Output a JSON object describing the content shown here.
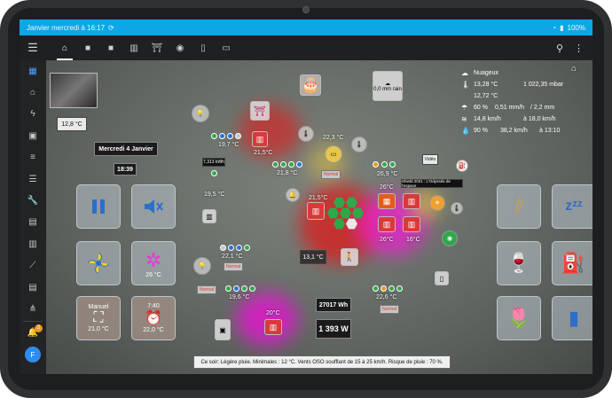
{
  "status_bar": {
    "time_text": "Janvier mercredi à 16:17",
    "battery": "100%"
  },
  "toolbar": {
    "tabs": [
      "home",
      "square-1",
      "square-2",
      "radiator",
      "gate",
      "eye",
      "phone",
      "tv"
    ],
    "search_icon": "search-icon",
    "more_icon": "more-vertical-icon"
  },
  "sidebar": {
    "items": [
      "dashboard",
      "home",
      "energy",
      "screen",
      "list",
      "list-alt",
      "wrench",
      "chart-bar",
      "server",
      "chart-line",
      "document",
      "network"
    ],
    "notification_count": "2",
    "user_initial": "F"
  },
  "camera": {
    "label": "camera-feed"
  },
  "temps": {
    "indoor_main": "12,8 °C",
    "date": "Mercredi 4 Janvier",
    "time": "18:39",
    "t1": "19,7 °C",
    "t2": "21,5°C",
    "t3": "21,8 °C",
    "t4": "22,3 °C",
    "t5": "26,9 °C",
    "t6": "19,5 °C",
    "t7": "21,5°C",
    "t8": "26°C",
    "t9": "26°C",
    "t10": "16°C",
    "t11": "22,1 °C",
    "t12": "13,1 °C",
    "t13": "22,6 °C",
    "t14": "19,6 °C",
    "t15": "20°C",
    "t16": "26 °C"
  },
  "energy": {
    "kwh": "7,313 kWh",
    "wh_total": "27017 Wh",
    "w_now": "1 393 W"
  },
  "labels": {
    "normal1": "Normal",
    "normal2": "Normal",
    "normal3": "Normal",
    "normal4": "Normal",
    "video": "Vidéo",
    "shield": "Shield 2021 : L'Odyssée de l'espace",
    "rain": "0,0 mm rain",
    "manuel": "Manuel",
    "alarm_time": "7:40",
    "on_temp": "21,0 °C",
    "alarm_temp": "22,0 °C",
    "fan_temp": "26 °C"
  },
  "weather": {
    "condition": "Nuageux",
    "temp_out": "13,28 °C",
    "temp_feel": "12,72 °C",
    "pressure": "1 022,35 mbar",
    "humidity_rain": "60 %",
    "rain_rate": "0,51 mm/h",
    "rain_total": "/ 2,2 mm",
    "wind": "14,8 km/h",
    "gust": "à 18,0 km/h",
    "hum2": "90 %",
    "wind_max": "38,2 km/h",
    "wind_time": "à 13:10"
  },
  "forecast": "Ce soir: Légère pluie. Minimales : 12 °C. Vents OSO soufflant de 15 à 25 km/h. Risque de pluie : 70 %."
}
